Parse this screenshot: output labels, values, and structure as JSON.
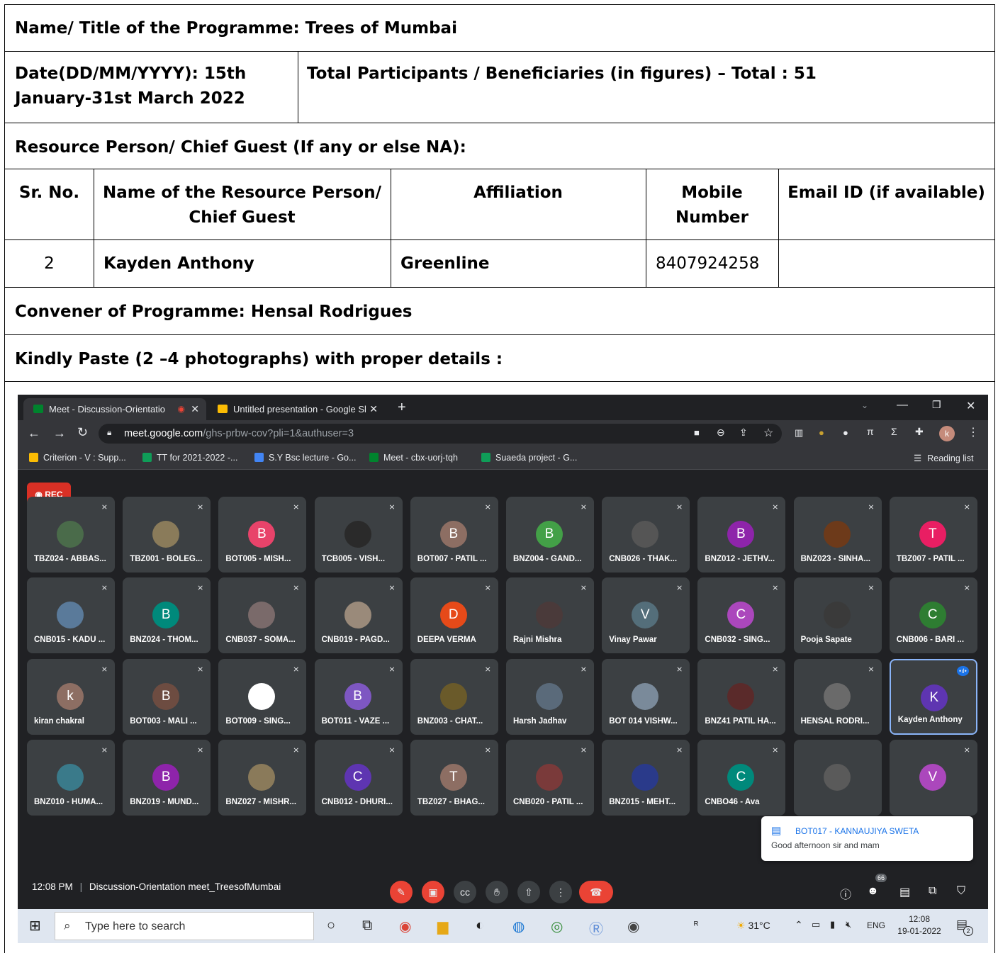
{
  "form": {
    "title": "Name/ Title of the Programme: Trees of Mumbai",
    "date_line1": "Date(DD/MM/YYYY): 15th",
    "date_line2": "January-31st March 2022",
    "participants": "Total Participants / Beneficiaries (in figures) –  Total : 51",
    "resource_heading": "Resource Person/ Chief Guest (If any or else NA):",
    "headers": {
      "sr": "Sr. No.",
      "name_l1": "Name of the Resource Person/",
      "name_l2": "Chief Guest",
      "affiliation": "Affiliation",
      "mobile_l1": "Mobile",
      "mobile_l2": "Number",
      "email": "Email ID (if available)"
    },
    "row": {
      "sr": "2",
      "name": "Kayden Anthony",
      "affiliation": "Greenline",
      "mobile": "8407924258",
      "email": ""
    },
    "convener": "Convener of Programme: Hensal Rodrigues",
    "photos_heading": "Kindly Paste (2 –4  photographs) with proper details :"
  },
  "browser": {
    "tab1": "Meet - Discussion-Orientatio",
    "tab2": "Untitled presentation - Google Sl",
    "url_host": "meet.google.com",
    "url_path": "/ghs-prbw-cov?pli=1&authuser=3",
    "profile_initial": "k",
    "bookmarks": [
      "Criterion - V : Supp...",
      "TT for 2021-2022 -...",
      "S.Y Bsc lecture - Go...",
      "Meet - cbx-uorj-tqh",
      "Suaeda project - G..."
    ],
    "reading_list": "Reading list",
    "colors": {
      "accent": "#1a73e8",
      "danger": "#ea4335"
    }
  },
  "meet": {
    "rec_label": "REC",
    "participants": [
      {
        "name": "TBZ024 - ABBAS...",
        "initial": "",
        "color": "#4a6b4a"
      },
      {
        "name": "TBZ001 - BOLEG...",
        "initial": "",
        "color": "#8a7b5a"
      },
      {
        "name": "BOT005 - MISH...",
        "initial": "B",
        "color": "#e8436a"
      },
      {
        "name": "TCB005 - VISH...",
        "initial": "",
        "color": "#2a2a2a"
      },
      {
        "name": "BOT007 - PATIL ...",
        "initial": "B",
        "color": "#8d6e63"
      },
      {
        "name": "BNZ004 - GAND...",
        "initial": "B",
        "color": "#43a047"
      },
      {
        "name": "CNB026 - THAK...",
        "initial": "",
        "color": "#555555"
      },
      {
        "name": "BNZ012 - JETHV...",
        "initial": "B",
        "color": "#8e24aa"
      },
      {
        "name": "BNZ023 - SINHA...",
        "initial": "",
        "color": "#6d3a1a"
      },
      {
        "name": "TBZ007 - PATIL ...",
        "initial": "T",
        "color": "#e91e63"
      },
      {
        "name": "CNB015 - KADU ...",
        "initial": "",
        "color": "#5a7a9a"
      },
      {
        "name": "BNZ024 - THOM...",
        "initial": "B",
        "color": "#00897b"
      },
      {
        "name": "CNB037 - SOMA...",
        "initial": "",
        "color": "#7a6a6a"
      },
      {
        "name": "CNB019 - PAGD...",
        "initial": "",
        "color": "#9a8a7a"
      },
      {
        "name": "DEEPA VERMA",
        "initial": "D",
        "color": "#e64a19"
      },
      {
        "name": "Rajni Mishra",
        "initial": "",
        "color": "#4a3a3a"
      },
      {
        "name": "Vinay Pawar",
        "initial": "V",
        "color": "#546e7a"
      },
      {
        "name": "CNB032 - SING...",
        "initial": "C",
        "color": "#ab47bc"
      },
      {
        "name": "Pooja Sapate",
        "initial": "",
        "color": "#3a3a3a"
      },
      {
        "name": "CNB006 - BARI ...",
        "initial": "C",
        "color": "#2e7d32"
      },
      {
        "name": "kiran chakral",
        "initial": "k",
        "color": "#8d6e63"
      },
      {
        "name": "BOT003 - MALI ...",
        "initial": "B",
        "color": "#6d4c41"
      },
      {
        "name": "BOT009 - SING...",
        "initial": "",
        "color": "#ffffff"
      },
      {
        "name": "BOT011 - VAZE ...",
        "initial": "B",
        "color": "#7e57c2"
      },
      {
        "name": "BNZ003 - CHAT...",
        "initial": "",
        "color": "#6a5a2a"
      },
      {
        "name": "Harsh Jadhav",
        "initial": "",
        "color": "#5a6a7a"
      },
      {
        "name": "BOT 014 VISHW...",
        "initial": "",
        "color": "#7a8a9a"
      },
      {
        "name": "BNZ41 PATIL HA...",
        "initial": "",
        "color": "#5a2a2a"
      },
      {
        "name": "HENSAL RODRI...",
        "initial": "",
        "color": "#6a6a6a"
      },
      {
        "name": "Kayden Anthony",
        "initial": "K",
        "color": "#5e35b1"
      },
      {
        "name": "BNZ010 - HUMA...",
        "initial": "",
        "color": "#3a7a8a"
      },
      {
        "name": "BNZ019 - MUND...",
        "initial": "B",
        "color": "#8e24aa"
      },
      {
        "name": "BNZ027 - MISHR...",
        "initial": "",
        "color": "#8a7a5a"
      },
      {
        "name": "CNB012 - DHURI...",
        "initial": "C",
        "color": "#5e35b1"
      },
      {
        "name": "TBZ027 - BHAG...",
        "initial": "T",
        "color": "#8d6e63"
      },
      {
        "name": "CNB020 - PATIL ...",
        "initial": "",
        "color": "#7a3a3a"
      },
      {
        "name": "BNZ015 - MEHT...",
        "initial": "",
        "color": "#2a3a8a"
      },
      {
        "name": "CNBO46 - Ava",
        "initial": "C",
        "color": "#00897b"
      },
      {
        "name": "",
        "initial": "",
        "color": "#5a5a5a"
      },
      {
        "name": "",
        "initial": "V",
        "color": "#ab47bc"
      }
    ],
    "chat_sender": "BOT017 - KANNAUJIYA SWETA",
    "chat_message": "Good afternoon sir and mam",
    "time": "12:08 PM",
    "meeting_name": "Discussion-Orientation meet_TreesofMumbai",
    "people_count": "66"
  },
  "taskbar": {
    "search_placeholder": "Type here to search",
    "weather": "31°C",
    "lang": "ENG",
    "clock_time": "12:08",
    "clock_date": "19-01-2022",
    "notif_count": "2"
  }
}
